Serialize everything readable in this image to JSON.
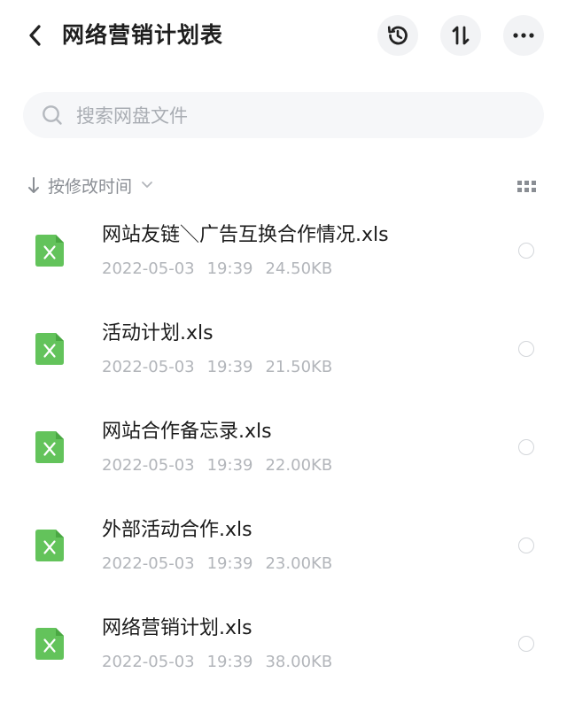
{
  "header": {
    "title": "网络营销计划表"
  },
  "icons": {
    "back": "chevron-left-icon",
    "history": "history-icon",
    "sort": "sort-arrows-icon",
    "more": "more-dots-icon",
    "search": "search-icon",
    "grid": "grid-view-icon",
    "file": "excel-file-icon"
  },
  "colors": {
    "excel_green": "#63c35b",
    "meta_gray": "#b2b5ba"
  },
  "search": {
    "placeholder": "搜索网盘文件"
  },
  "sort": {
    "label": "按修改时间"
  },
  "files": [
    {
      "name": "网站友链＼广告互换合作情况.xls",
      "date": "2022-05-03",
      "time": "19:39",
      "size": "24.50KB"
    },
    {
      "name": "活动计划.xls",
      "date": "2022-05-03",
      "time": "19:39",
      "size": "21.50KB"
    },
    {
      "name": "网站合作备忘录.xls",
      "date": "2022-05-03",
      "time": "19:39",
      "size": "22.00KB"
    },
    {
      "name": "外部活动合作.xls",
      "date": "2022-05-03",
      "time": "19:39",
      "size": "23.00KB"
    },
    {
      "name": "网络营销计划.xls",
      "date": "2022-05-03",
      "time": "19:39",
      "size": "38.00KB"
    }
  ]
}
